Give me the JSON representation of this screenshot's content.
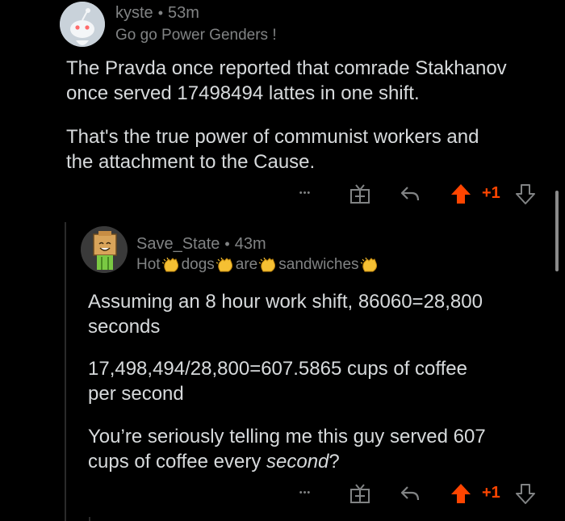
{
  "comment1": {
    "username": "kyste",
    "dot": "•",
    "time": "53m",
    "flair": "Go go Power Genders !",
    "paragraphs": [
      [
        "The Pravda once reported that comrade Stakhanov",
        "once served 17498494 lattes in one shift."
      ],
      [
        "That's the true power of communist workers and",
        "the attachment to the Cause."
      ]
    ],
    "actions": {
      "more": "•••",
      "score": "+1"
    }
  },
  "comment2": {
    "username": "Save_State",
    "dot": "•",
    "time": "43m",
    "flair_words": [
      "Hot",
      "dogs",
      "are",
      "sandwiches"
    ],
    "paragraphs": [
      [
        "Assuming an 8 hour work shift, 86060=28,800",
        "seconds"
      ],
      [
        "17,498,494/28,800=607.5865 cups of coffee",
        "per second"
      ]
    ],
    "p3_line1": "You’re seriously telling me this guy served 607",
    "p3_line2_start": "cups of coffee every ",
    "p3_line2_em": "second",
    "p3_line2_end": "?",
    "actions": {
      "more": "•••",
      "score": "+1"
    }
  },
  "colors": {
    "background": "#000000",
    "text": "#d7dadc",
    "muted": "#818384",
    "upvote": "#ff4500"
  },
  "icons": [
    "snoo-avatar",
    "gift-icon",
    "reply-icon",
    "upvote-icon",
    "downvote-icon",
    "clap-emoji"
  ]
}
